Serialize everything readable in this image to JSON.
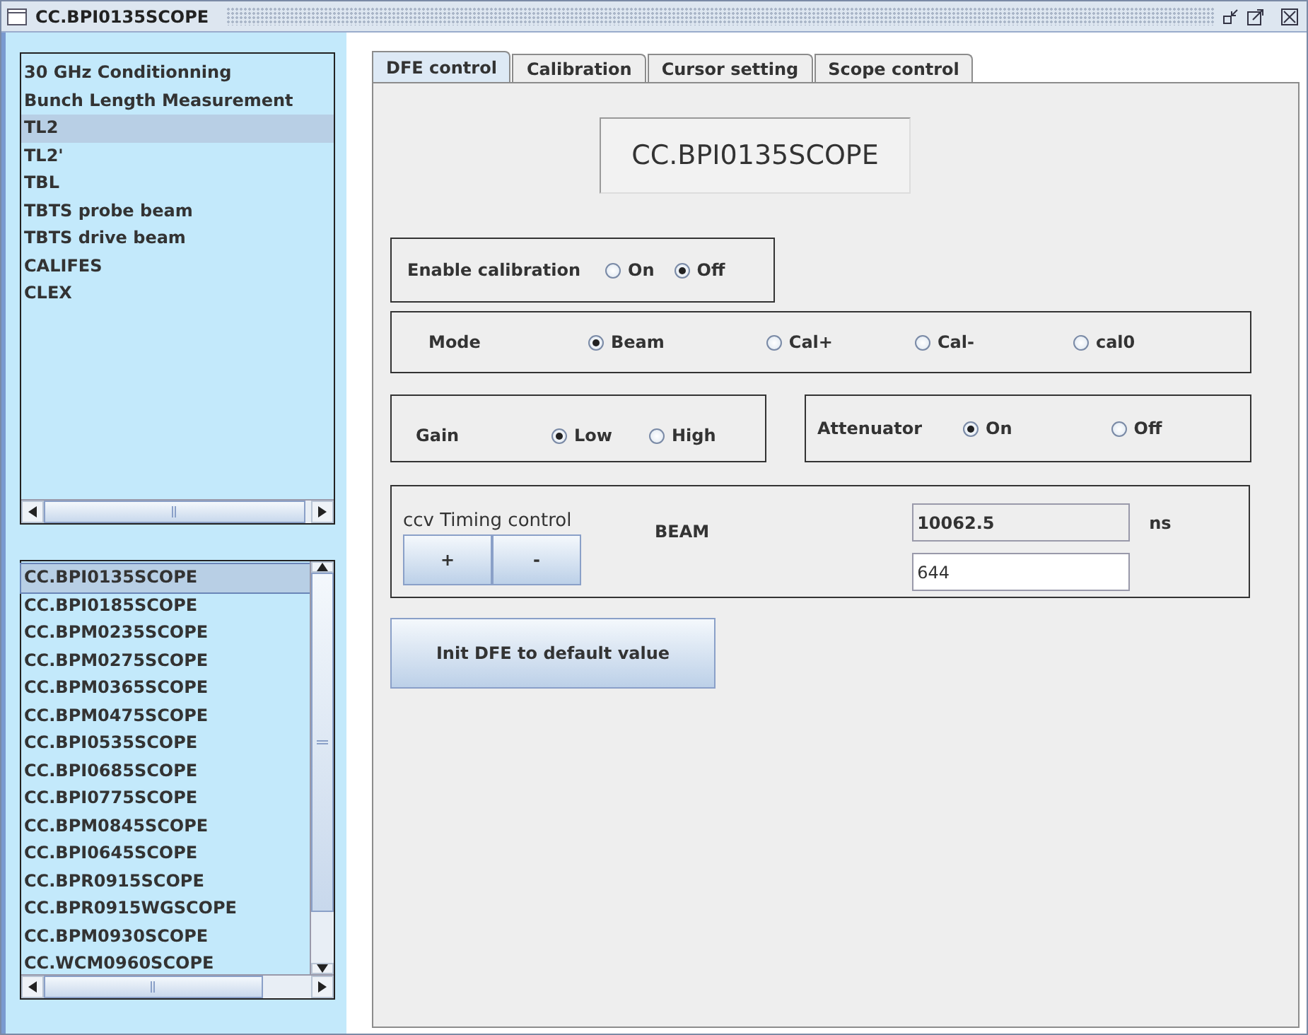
{
  "window": {
    "title": "CC.BPI0135SCOPE"
  },
  "area_list": {
    "items": [
      {
        "label": "30 GHz Conditionning",
        "selected": false
      },
      {
        "label": "Bunch Length Measurement",
        "selected": false
      },
      {
        "label": "TL2",
        "selected": true
      },
      {
        "label": "TL2'",
        "selected": false
      },
      {
        "label": "TBL",
        "selected": false
      },
      {
        "label": "TBTS probe beam",
        "selected": false
      },
      {
        "label": "TBTS drive beam",
        "selected": false
      },
      {
        "label": "CALIFES",
        "selected": false
      },
      {
        "label": "CLEX",
        "selected": false
      }
    ]
  },
  "device_list": {
    "items": [
      {
        "label": "CC.BPI0135SCOPE",
        "selected": true
      },
      {
        "label": "CC.BPI0185SCOPE",
        "selected": false
      },
      {
        "label": "CC.BPM0235SCOPE",
        "selected": false
      },
      {
        "label": "CC.BPM0275SCOPE",
        "selected": false
      },
      {
        "label": "CC.BPM0365SCOPE",
        "selected": false
      },
      {
        "label": "CC.BPM0475SCOPE",
        "selected": false
      },
      {
        "label": "CC.BPI0535SCOPE",
        "selected": false
      },
      {
        "label": "CC.BPI0685SCOPE",
        "selected": false
      },
      {
        "label": "CC.BPI0775SCOPE",
        "selected": false
      },
      {
        "label": "CC.BPM0845SCOPE",
        "selected": false
      },
      {
        "label": "CC.BPI0645SCOPE",
        "selected": false
      },
      {
        "label": "CC.BPR0915SCOPE",
        "selected": false
      },
      {
        "label": "CC.BPR0915WGSCOPE",
        "selected": false
      },
      {
        "label": "CC.BPM0930SCOPE",
        "selected": false
      },
      {
        "label": "CC.WCM0960SCOPE",
        "selected": false
      }
    ]
  },
  "tabs": [
    {
      "label": "DFE control",
      "selected": true
    },
    {
      "label": "Calibration",
      "selected": false
    },
    {
      "label": "Cursor setting",
      "selected": false
    },
    {
      "label": "Scope control",
      "selected": false
    }
  ],
  "device_header": "CC.BPI0135SCOPE",
  "enable_calibration": {
    "label": "Enable calibration",
    "options": [
      {
        "label": "On",
        "selected": false
      },
      {
        "label": "Off",
        "selected": true
      }
    ]
  },
  "mode": {
    "label": "Mode",
    "options": [
      {
        "label": "Beam",
        "selected": true
      },
      {
        "label": "Cal+",
        "selected": false
      },
      {
        "label": "Cal-",
        "selected": false
      },
      {
        "label": "cal0",
        "selected": false
      }
    ]
  },
  "gain": {
    "label": "Gain",
    "options": [
      {
        "label": "Low",
        "selected": true
      },
      {
        "label": "High",
        "selected": false
      }
    ]
  },
  "attenuator": {
    "label": "Attenuator",
    "options": [
      {
        "label": "On",
        "selected": true
      },
      {
        "label": "Off",
        "selected": false
      }
    ]
  },
  "timing": {
    "label": "ccv Timing control",
    "mode": "BEAM",
    "buttons": [
      "+",
      "-"
    ],
    "readout": "10062.5",
    "unit": "ns",
    "value": "644"
  },
  "init_button": "Init DFE to default value"
}
